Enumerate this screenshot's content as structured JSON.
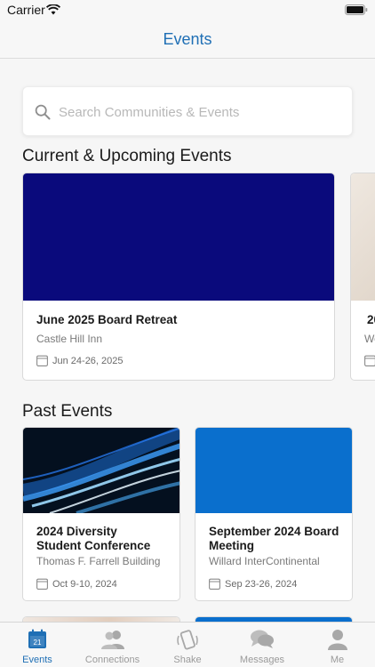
{
  "status_bar": {
    "carrier": "Carrier",
    "time": ""
  },
  "nav": {
    "title": "Events"
  },
  "search": {
    "placeholder": "Search Communities & Events",
    "value": ""
  },
  "sections": {
    "upcoming_title": "Current & Upcoming Events",
    "past_title": "Past Events"
  },
  "upcoming_events": [
    {
      "title": "June 2025 Board Retreat",
      "venue": "Castle Hill Inn",
      "date": "Jun 24-26, 2025",
      "image_color": "#0a0a7c"
    },
    {
      "title": "20",
      "venue": "We",
      "date": "",
      "image_color": "#e4dcd2"
    }
  ],
  "past_events": [
    {
      "title_line1": "2024 Diversity",
      "title_line2": "Student Conference",
      "venue": "Thomas F. Farrell Building",
      "date": "Oct 9-10, 2024",
      "image": "light-streaks"
    },
    {
      "title_line1": "September 2024 Board",
      "title_line2": "Meeting",
      "venue": "Willard InterContinental",
      "date": "Sep 23-26, 2024",
      "image_color": "#0a6fcd"
    }
  ],
  "tabs": [
    {
      "label": "Events",
      "icon": "calendar-icon",
      "badge": "21",
      "active": true
    },
    {
      "label": "Connections",
      "icon": "people-icon",
      "active": false
    },
    {
      "label": "Shake",
      "icon": "phone-shake-icon",
      "active": false
    },
    {
      "label": "Messages",
      "icon": "chat-bubbles-icon",
      "active": false
    },
    {
      "label": "Me",
      "icon": "person-icon",
      "active": false
    }
  ],
  "colors": {
    "accent": "#1f6fb5",
    "retreat_image": "#0a0a7c",
    "board_meeting_image": "#0a6fcd"
  }
}
